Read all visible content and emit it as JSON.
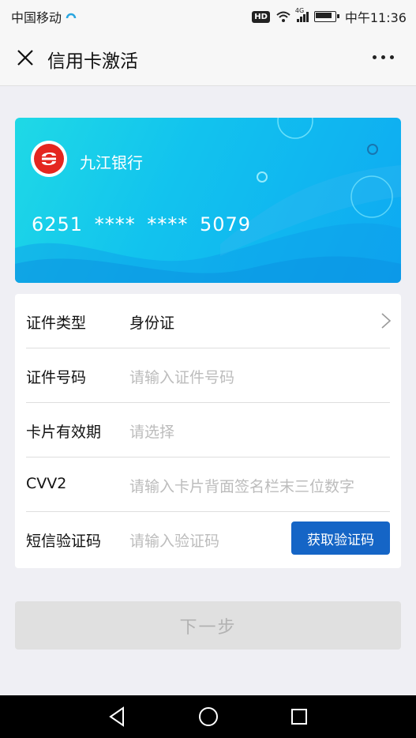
{
  "status_bar": {
    "carrier": "中国移动",
    "network": "4G",
    "hd_badge": "HD",
    "time": "中午11:36"
  },
  "navbar": {
    "title": "信用卡激活",
    "close_icon": "close-icon",
    "more_icon": "more-dots-icon"
  },
  "card": {
    "bank_name": "九江银行",
    "card_number": "6251 **** **** 5079",
    "logo_icon": "bank-logo-icon",
    "colors": {
      "gradient_start": "#1fd9e6",
      "gradient_end": "#0ea9f2"
    }
  },
  "form": {
    "id_type": {
      "label": "证件类型",
      "value": "身份证"
    },
    "id_number": {
      "label": "证件号码",
      "placeholder": "请输入证件号码"
    },
    "expiry": {
      "label": "卡片有效期",
      "placeholder": "请选择"
    },
    "cvv": {
      "label": "CVV2",
      "placeholder": "请输入卡片背面签名栏末三位数字"
    },
    "sms": {
      "label": "短信验证码",
      "placeholder": "请输入验证码",
      "button": "获取验证码"
    }
  },
  "next_button": "下一步",
  "accent_color": "#1565c6"
}
